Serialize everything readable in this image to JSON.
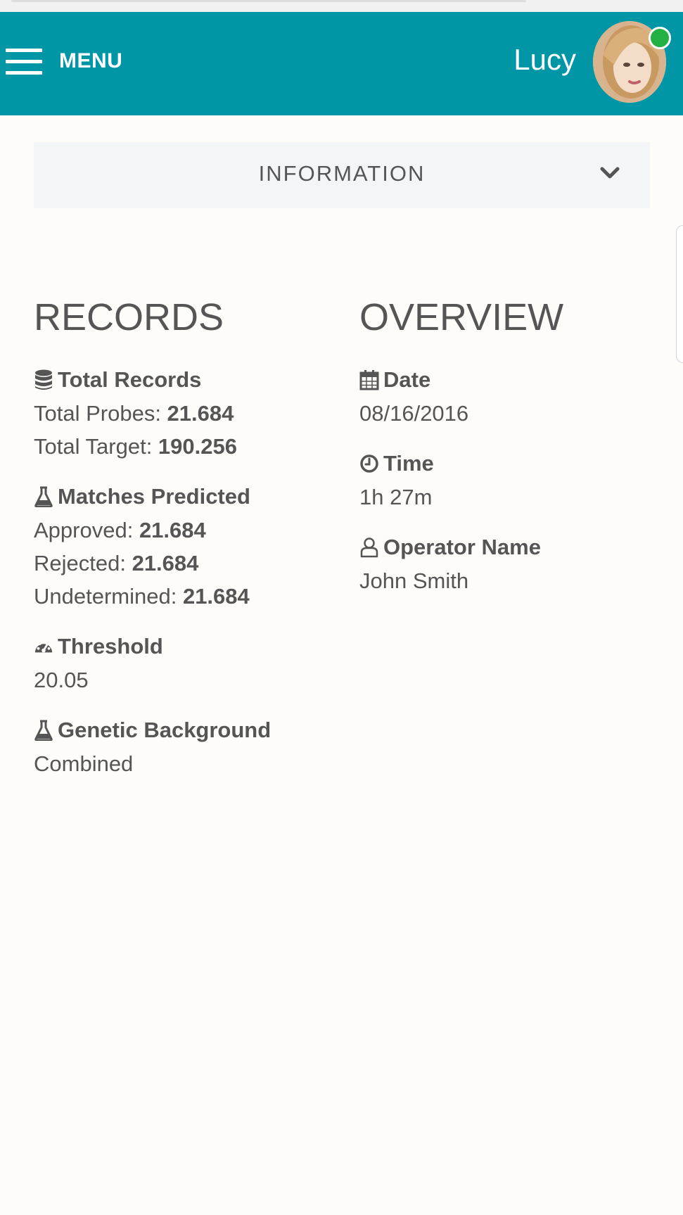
{
  "header": {
    "menu_label": "MENU",
    "user_name": "Lucy",
    "status": "online",
    "status_color": "#23b144",
    "brand_color": "#0096a6"
  },
  "info_bar": {
    "title": "INFORMATION",
    "icon": "chevron-down-icon"
  },
  "records": {
    "title": "RECORDS",
    "total_records": {
      "heading": "Total Records",
      "icon": "database-icon",
      "probes_label": "Total Probes: ",
      "probes_value": "21.684",
      "target_label": "Total Target: ",
      "target_value": "190.256"
    },
    "matches": {
      "heading": "Matches Predicted",
      "icon": "flask-icon",
      "approved_label": "Approved: ",
      "approved_value": "21.684",
      "rejected_label": "Rejected: ",
      "rejected_value": "21.684",
      "undetermined_label": "Undetermined: ",
      "undetermined_value": "21.684"
    },
    "threshold": {
      "heading": "Threshold",
      "icon": "dashboard-icon",
      "value": "20.05"
    },
    "genetic": {
      "heading": "Genetic Background",
      "icon": "flask-icon",
      "value": "Combined"
    }
  },
  "overview": {
    "title": "OVERVIEW",
    "date": {
      "heading": "Date",
      "icon": "calendar-icon",
      "value": "08/16/2016"
    },
    "time": {
      "heading": "Time",
      "icon": "clock-icon",
      "value": "1h 27m"
    },
    "operator": {
      "heading": "Operator Name",
      "icon": "user-icon",
      "value": "John Smith"
    }
  }
}
